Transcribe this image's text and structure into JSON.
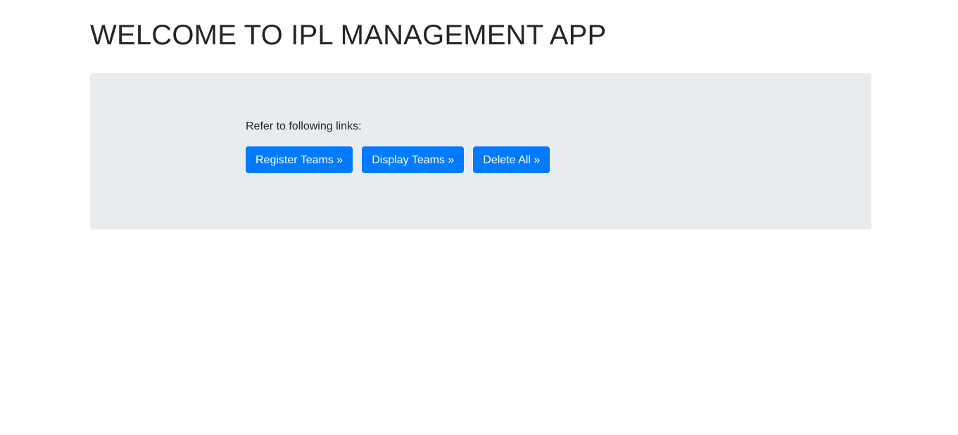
{
  "header": {
    "title": "WELCOME TO IPL MANAGEMENT APP"
  },
  "main": {
    "intro_text": "Refer to following links:",
    "buttons": [
      {
        "label": "Register Teams »"
      },
      {
        "label": "Display Teams »"
      },
      {
        "label": "Delete All »"
      }
    ]
  },
  "colors": {
    "primary": "#007bff",
    "jumbotron_bg": "#e9ecef",
    "text": "#212529"
  }
}
